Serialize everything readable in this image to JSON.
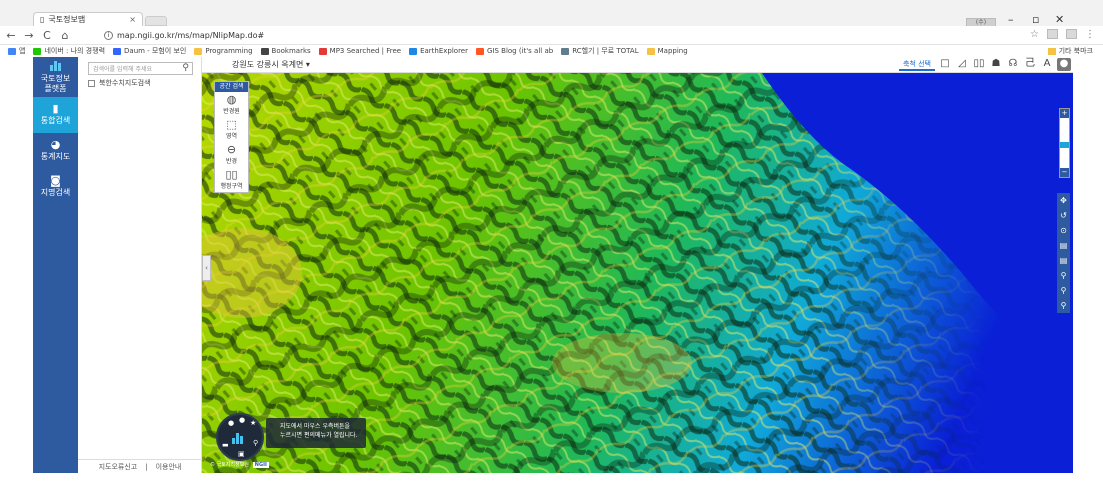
{
  "browser": {
    "tab_title": "국토정보맵",
    "tab_close": "×",
    "url": "map.ngii.go.kr/ms/map/NlipMap.do#",
    "window_user": "(수)",
    "nav": {
      "back": "←",
      "forward": "→",
      "reload": "C",
      "home": "⌂"
    },
    "bookmarks": [
      {
        "label": "앱",
        "color": "#4285f4"
      },
      {
        "label": "네이버 : 나의 경쟁력",
        "color": "#1ec800"
      },
      {
        "label": "Daum - 모험이 보인",
        "color": "#3366ff"
      },
      {
        "label": "Programming",
        "color": "#f6c243"
      },
      {
        "label": "Bookmarks",
        "color": "#444444"
      },
      {
        "label": "MP3 Searched | Free",
        "color": "#e53935"
      },
      {
        "label": "EarthExplorer",
        "color": "#1e88e5"
      },
      {
        "label": "GIS Blog (it's all ab",
        "color": "#ff5722"
      },
      {
        "label": "RC헬기 | 무료 TOTAL",
        "color": "#607d8b"
      },
      {
        "label": "Mapping",
        "color": "#f6c243"
      }
    ],
    "bookmarks_other": "기타 북마크"
  },
  "leftnav": {
    "items": [
      {
        "label": "국토정보\n플랫폼",
        "icon": "bar-chart-logo"
      },
      {
        "label": "통합검색",
        "icon": "mouse-icon"
      },
      {
        "label": "통계지도",
        "icon": "pie-icon"
      },
      {
        "label": "지명검색",
        "icon": "camera-icon"
      }
    ]
  },
  "panel": {
    "search_placeholder": "검색어를 입력해 주세요",
    "checkbox_label": "북한수치지도검색",
    "footer": {
      "left": "지도오류신고",
      "sep": "|",
      "right": "이용안내"
    }
  },
  "maptop": {
    "region": "강원도 강릉시 옥계면 ▾",
    "scale_button": "축척 선택",
    "tools": [
      "□",
      "◿",
      "▯▯",
      "☗",
      "☊",
      "己",
      "A"
    ]
  },
  "spatial_search": {
    "title": "공간 검색",
    "items": [
      {
        "label": "반경원",
        "icon": "globe-icon",
        "glyph": "◍"
      },
      {
        "label": "영역",
        "icon": "area-icon",
        "glyph": "⬚"
      },
      {
        "label": "반경",
        "icon": "radius-icon",
        "glyph": "⊖"
      },
      {
        "label": "행정구역",
        "icon": "map-book-icon",
        "glyph": "▯▯"
      }
    ]
  },
  "zoom": {
    "plus": "+",
    "minus": "−",
    "level_fraction": 0.55
  },
  "sidetools": [
    "✥",
    "↺",
    "⊙",
    "▤",
    "▤",
    "⚲",
    "⚲",
    "⚲"
  ],
  "tooltip": {
    "text": "지도에서 마우스 우측버튼을\n누르시면 편의메뉴가 열립니다."
  },
  "copyright": {
    "left": "© 국토지리정보원",
    "badge": "NGII"
  },
  "colors": {
    "nav": "#2e5aa0",
    "nav_active": "#1fa4d9",
    "sea": "#0a1fd6",
    "accent": "#1a6fd1"
  }
}
